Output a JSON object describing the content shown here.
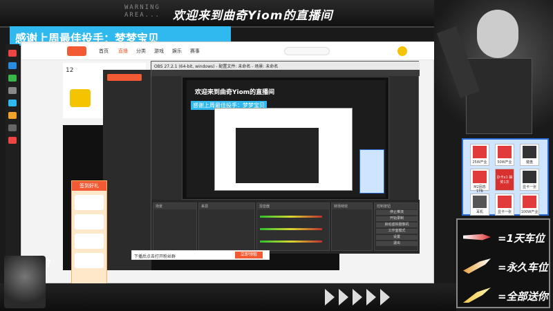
{
  "overlay": {
    "warning_line1": "WARNING",
    "warning_line2": "AREA...",
    "title": "欢迎来到曲奇Yiom的直播间",
    "thanks": "感谢上周最佳投手：梦梦宝贝"
  },
  "browser": {
    "nav": [
      "首页",
      "直播",
      "分类",
      "游戏",
      "娱乐",
      "赛事"
    ],
    "bottom_text": "下播后点击打开粉丝群",
    "bottom_button": "立即领取"
  },
  "obs": {
    "title": "OBS 27.2.1 (64-bit, windows) - 配置文件: 未命名 - 场景: 未命名",
    "menu": [
      "文件(F)",
      "编辑(E)",
      "视图(V)",
      "停靠部件(D)",
      "配置文件(P)",
      "场景集合(S)",
      "工具(T)",
      "帮助(H)"
    ],
    "mini_title": "欢迎来到曲奇Yiom的直播间",
    "mini_thanks": "感谢上周最佳投手：梦梦宝贝",
    "docks": [
      "场景",
      "来源",
      "混音器",
      "转场特效",
      "控制按钮"
    ],
    "buttons": [
      "停止推流",
      "开始录制",
      "启动虚拟摄像机",
      "工作室模式",
      "设置",
      "退出"
    ]
  },
  "rewards": {
    "gifts": [
      {
        "label": "25W产业",
        "color": "#e23b3b"
      },
      {
        "label": "50W产业",
        "color": "#e23b3b"
      },
      {
        "label": "键盘",
        "color": "#333333"
      },
      {
        "label": "M2固态1TB",
        "color": "#e23b3b"
      },
      {
        "label": "办卡x1 抽奖1次",
        "color": "#d93030"
      },
      {
        "label": "显卡一张",
        "color": "#333333"
      },
      {
        "label": "耳机",
        "color": "#555555"
      },
      {
        "label": "显卡一张",
        "color": "#e23b3b"
      },
      {
        "label": "100W产业",
        "color": "#e23b3b"
      }
    ]
  },
  "tiers": [
    {
      "label": "=1天车位",
      "icon": "jet-icon",
      "color": "#d33"
    },
    {
      "label": "=永久车位",
      "icon": "rocket-icon",
      "color": "#e8a33c"
    },
    {
      "label": "=全部送你",
      "icon": "golden-rocket-icon",
      "color": "#f2c64a"
    }
  ],
  "chibi_mark": "?",
  "colors": {
    "accent": "#2fb9ef",
    "brand": "#f25a33",
    "reward_border": "#2c6bd6"
  }
}
